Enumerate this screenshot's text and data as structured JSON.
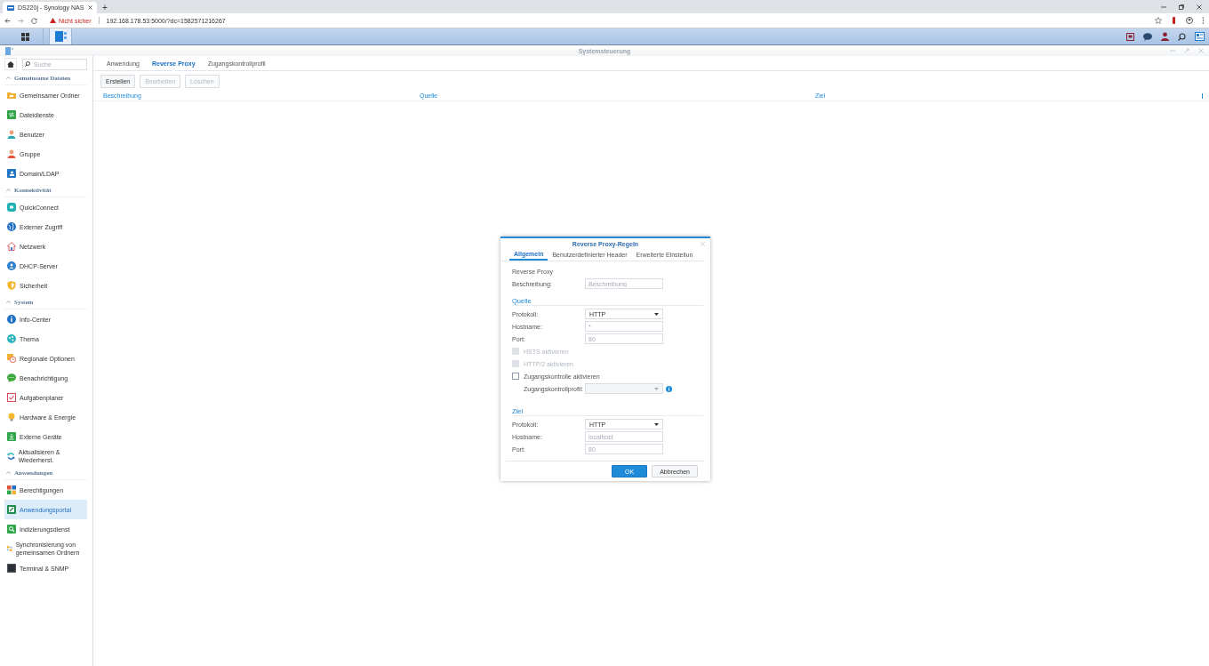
{
  "browser": {
    "tab_title": "DS220j - Synology NAS",
    "new_tab": "+",
    "security": "Nicht sicher",
    "url": "192.168.178.53:5000/?dc=1582571216267"
  },
  "window": {
    "title": "Systemsteuerung"
  },
  "sidebar": {
    "search": {
      "placeholder": "Suche"
    },
    "sections": [
      {
        "title": "Gemeinsame Dateien",
        "expanded": true,
        "items": [
          {
            "label": "Gemeinsamer Ordner",
            "selected": false
          },
          {
            "label": "Dateidienste",
            "selected": false
          },
          {
            "label": "Benutzer",
            "selected": false
          },
          {
            "label": "Gruppe",
            "selected": false
          },
          {
            "label": "Domain/LDAP",
            "selected": false
          }
        ]
      },
      {
        "title": "Konnektivität",
        "expanded": true,
        "items": [
          {
            "label": "QuickConnect",
            "selected": false
          },
          {
            "label": "Externer Zugriff",
            "selected": false
          },
          {
            "label": "Netzwerk",
            "selected": false
          },
          {
            "label": "DHCP-Server",
            "selected": false
          },
          {
            "label": "Sicherheit",
            "selected": false
          }
        ]
      },
      {
        "title": "System",
        "expanded": true,
        "items": [
          {
            "label": "Info-Center",
            "selected": false
          },
          {
            "label": "Thema",
            "selected": false
          },
          {
            "label": "Regionale Optionen",
            "selected": false
          },
          {
            "label": "Benachrichtigung",
            "selected": false
          },
          {
            "label": "Aufgabenplaner",
            "selected": false
          },
          {
            "label": "Hardware & Energie",
            "selected": false
          },
          {
            "label": "Externe Geräte",
            "selected": false
          },
          {
            "label": "Aktualisieren & Wiederherst.",
            "selected": false
          }
        ]
      },
      {
        "title": "Anwendungen",
        "expanded": true,
        "items": [
          {
            "label": "Berechtigungen",
            "selected": false
          },
          {
            "label": "Anwendungsportal",
            "selected": true
          },
          {
            "label": "Indizierungsdienst",
            "selected": false
          },
          {
            "label": "Synchronisierung von gemeinsamen Ordnern",
            "selected": false
          },
          {
            "label": "Terminal & SNMP",
            "selected": false
          }
        ]
      }
    ]
  },
  "tabs": [
    {
      "label": "Anwendung",
      "selected": false
    },
    {
      "label": "Reverse Proxy",
      "selected": true
    },
    {
      "label": "Zugangskontrollprofil",
      "selected": false
    }
  ],
  "toolbar": [
    {
      "label": "Erstellen",
      "disabled": false
    },
    {
      "label": "Bearbeiten",
      "disabled": true
    },
    {
      "label": "Löschen",
      "disabled": true
    }
  ],
  "table": {
    "columns": [
      "Beschreibung",
      "Quelle",
      "Ziel"
    ]
  },
  "dialog": {
    "title": "Reverse Proxy-Regeln",
    "tabs": [
      {
        "label": "Allgemein",
        "selected": true
      },
      {
        "label": "Benutzerdefinierter Header",
        "selected": false
      },
      {
        "label": "Erweiterte Einstellun",
        "selected": false
      }
    ],
    "rows": [
      {
        "kind": "caption",
        "label": "Reverse Proxy"
      },
      {
        "kind": "text",
        "label": "Beschreibung:",
        "placeholder": "Beschreibung"
      },
      {
        "kind": "heading",
        "label": "Quelle"
      },
      {
        "kind": "select",
        "label": "Protokoll:",
        "value": "HTTP",
        "disabled": false
      },
      {
        "kind": "text",
        "label": "Hostname:",
        "placeholder": "*"
      },
      {
        "kind": "text",
        "label": "Port:",
        "placeholder": "80"
      },
      {
        "kind": "checkbox",
        "label": "HSTS aktivieren",
        "checked": false,
        "disabled": true
      },
      {
        "kind": "checkbox",
        "label": "HTTP/2 aktivieren",
        "checked": false,
        "disabled": true
      },
      {
        "kind": "checkbox",
        "label": "Zugangskontrolle aktivieren",
        "checked": false,
        "disabled": false,
        "children": [
          {
            "kind": "select",
            "label": "Zugangskontrollprofil:",
            "disabled": true,
            "info": true
          }
        ]
      },
      {
        "kind": "heading",
        "label": "Ziel"
      },
      {
        "kind": "select",
        "label": "Protokoll:",
        "value": "HTTP",
        "disabled": false
      },
      {
        "kind": "text",
        "label": "Hostname:",
        "placeholder": "localhost"
      },
      {
        "kind": "text",
        "label": "Port:",
        "placeholder": "80"
      }
    ],
    "buttons": [
      {
        "label": "OK",
        "kind": "primary"
      },
      {
        "label": "Abbrechen",
        "kind": "secondary"
      }
    ]
  }
}
